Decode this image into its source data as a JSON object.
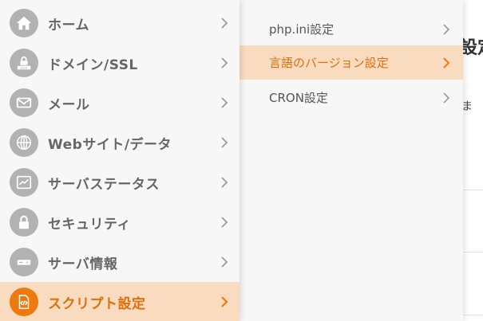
{
  "colors": {
    "accent": "#ee7a0e",
    "accent_text": "#de6f0b",
    "active_bg": "#f9dcc0",
    "icon_bg": "#b2b2b2",
    "menu_bg": "#f7f7f7"
  },
  "background_page": {
    "heading": "設定",
    "text": "ま"
  },
  "main_menu": {
    "items": [
      {
        "label": "ホーム",
        "icon": "home-icon",
        "active": false
      },
      {
        "label": "ドメイン/SSL",
        "icon": "lock-icon",
        "active": false
      },
      {
        "label": "メール",
        "icon": "mail-icon",
        "active": false
      },
      {
        "label": "Webサイト/データ",
        "icon": "globe-icon",
        "active": false
      },
      {
        "label": "サーバステータス",
        "icon": "chart-icon",
        "active": false
      },
      {
        "label": "セキュリティ",
        "icon": "padlock-icon",
        "active": false
      },
      {
        "label": "サーバ情報",
        "icon": "server-icon",
        "active": false
      },
      {
        "label": "スクリプト設定",
        "icon": "code-file-icon",
        "active": true
      }
    ]
  },
  "sub_menu": {
    "items": [
      {
        "label": "php.ini設定",
        "active": false
      },
      {
        "label": "言語のバージョン設定",
        "active": true
      },
      {
        "label": "CRON設定",
        "active": false
      }
    ]
  }
}
